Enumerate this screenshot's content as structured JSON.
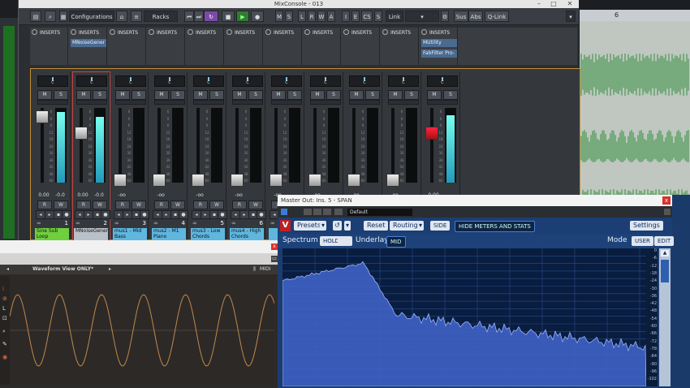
{
  "mix_window": {
    "title": "MixConsole - 013",
    "toolbar": {
      "configurations": "Configurations",
      "racks": "Racks",
      "m": "M",
      "s": "S",
      "l": "L",
      "r": "R",
      "w": "W",
      "a": "A",
      "i": "I",
      "e": "E",
      "cs": "CS",
      "s2": "S",
      "link": "Link",
      "sus": "Sus",
      "abs": "Abs",
      "qlink": "Q-Link"
    },
    "inserts_label": "INSERTS",
    "insert_plugins": {
      "ch2": "MNoiseGener",
      "ch11a": "MUtility",
      "ch11b": "FabFilter Pro-"
    },
    "channels": [
      {
        "num": "1",
        "name": "Sine Sub Loop",
        "value": "0.00",
        "value2": "-0.0",
        "pan": "C",
        "color": "#6fcf3f",
        "level": 0.97,
        "meter": 0.95
      },
      {
        "num": "2",
        "name": "MNoiseGener",
        "value": "0.00",
        "value2": "-0.0",
        "pan": "C",
        "color": "#b9c0c7",
        "level": 0.73,
        "meter": 0.88
      },
      {
        "num": "3",
        "name": "mus1 - Mid Bass",
        "value": "-oo",
        "value2": "",
        "pan": "C",
        "color": "#5fb7e0",
        "level": 0.06,
        "meter": 0
      },
      {
        "num": "4",
        "name": "mus2 - M1 Piano",
        "value": "-oo",
        "value2": "",
        "pan": "C",
        "color": "#5fb7e0",
        "level": 0.06,
        "meter": 0
      },
      {
        "num": "5",
        "name": "mus3 - Low Chords",
        "value": "-oo",
        "value2": "",
        "pan": "C",
        "color": "#5fb7e0",
        "level": 0.06,
        "meter": 0
      },
      {
        "num": "6",
        "name": "mus4 - High Chords",
        "value": "-oo",
        "value2": "",
        "pan": "C",
        "color": "#5fb7e0",
        "level": 0.06,
        "meter": 0
      },
      {
        "num": "",
        "name": "",
        "value": "-oo",
        "value2": "",
        "pan": "C",
        "color": "#5fb7e0",
        "level": 0.06,
        "meter": 0
      },
      {
        "num": "",
        "name": "",
        "value": "-oo",
        "value2": "",
        "pan": "C",
        "color": "#5fb7e0",
        "level": 0.06,
        "meter": 0
      },
      {
        "num": "",
        "name": "",
        "value": "-oo",
        "value2": "",
        "pan": "C",
        "color": "#5fb7e0",
        "level": 0.06,
        "meter": 0
      },
      {
        "num": "",
        "name": "",
        "value": "-oo",
        "value2": "",
        "pan": "C",
        "color": "#5fb7e0",
        "level": 0.06,
        "meter": 0
      },
      {
        "num": "",
        "name": "",
        "value": "0.00",
        "value2": "",
        "pan": "C",
        "color": "#5fb7e0",
        "level": 0.73,
        "meter": 0.9
      }
    ],
    "meter_scale": [
      "6",
      "0",
      "6",
      "12",
      "18",
      "24",
      "30",
      "36",
      "42",
      "48",
      "60"
    ]
  },
  "arrange": {
    "ruler_mark": "6"
  },
  "waveform_view": {
    "title": "Waveform View ONLY*",
    "midi_label": "MIDI"
  },
  "span": {
    "title": "Master Out: Ins. 5 - SPAN",
    "preset_name": "Default",
    "presets": "Presets",
    "reset": "Reset",
    "routing": "Routing",
    "side": "SIDE",
    "hide_meters": "HIDE METERS AND STATS",
    "settings": "Settings",
    "spectrum": "Spectrum",
    "hold": "HOLD",
    "underlay": "Underlay",
    "mid": "MID",
    "mode": "Mode",
    "user": "USER",
    "edit": "EDIT",
    "db_scale": [
      "0",
      "-6",
      "-12",
      "-18",
      "-24",
      "-30",
      "-36",
      "-42",
      "-48",
      "-54",
      "-60",
      "-66",
      "-72",
      "-78",
      "-84",
      "-90",
      "-96",
      "-102"
    ]
  }
}
